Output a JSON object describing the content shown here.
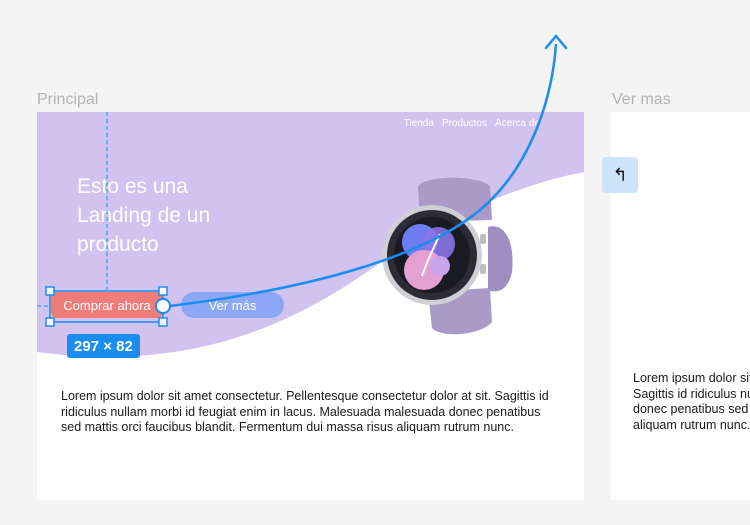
{
  "frames": {
    "principal_label": "Principal",
    "vermas_label": "Ver mas"
  },
  "nav": {
    "items": [
      "Tienda",
      "Productos",
      "Acerca de"
    ]
  },
  "hero": {
    "title": "Esto es una Landing de un producto",
    "buy_label": "Comprar ahora",
    "more_label": "Ver más"
  },
  "content": {
    "paragraph": "Lorem ipsum dolor sit amet consectetur. Pellentesque consectetur dolor at sit. Sagittis id ridiculus nullam morbi id feugiat enim in lacus. Malesuada malesuada donec penatibus sed mattis orci faucibus blandit. Fermentum dui massa risus aliquam rutrum nunc.",
    "paragraph_lines": [
      "Lorem ipsum dolor sit amet consectetur.",
      "Sagittis id ridiculus nullam morbi id",
      "donec penatibus sed mattis orci",
      "aliquam rutrum nunc."
    ]
  },
  "selection": {
    "size": "297 × 82"
  },
  "colors": {
    "hero_purple": "#d0c3ef",
    "accent_blue": "#1b8cf0",
    "buy_button": "#ef7c78",
    "more_button": "#8ca8f5"
  },
  "icons": {
    "back": "back-arrow-icon",
    "product": "smartwatch-image"
  }
}
